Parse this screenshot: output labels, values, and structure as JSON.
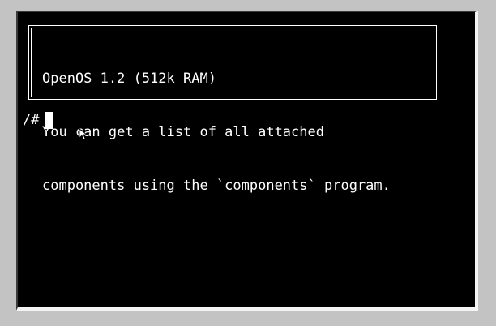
{
  "terminal": {
    "motd_lines": [
      "OpenOS 1.2 (512k RAM)",
      "You can get a list of all attached",
      "components using the `components` program."
    ],
    "prompt": "/#"
  },
  "colors": {
    "background": "#c3c3c3",
    "screen": "#000000",
    "text": "#ffffff"
  },
  "icons": {
    "pointer": "mouse-pointer-icon",
    "cursor": "text-cursor-block"
  }
}
